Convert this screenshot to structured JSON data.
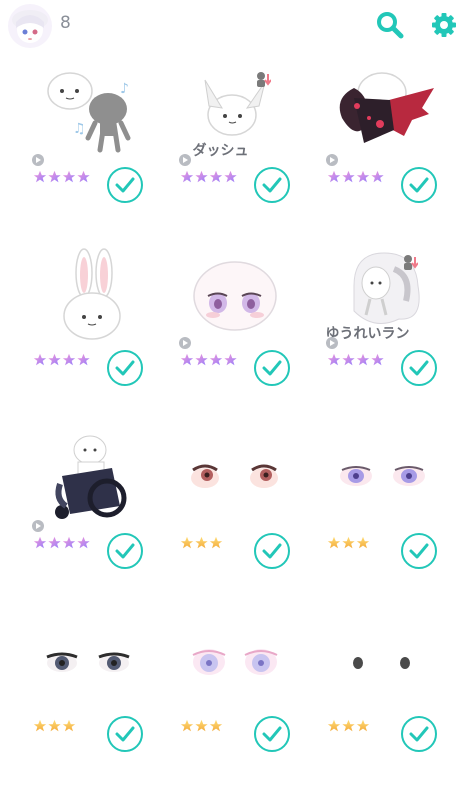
{
  "header": {
    "avatar_icon": "character-avatar-icon",
    "count": "8",
    "search_icon": "search-icon",
    "settings_icon": "gear-icon",
    "accent": "#22c7b8"
  },
  "items": [
    {
      "art": "music-bodies",
      "caption": "",
      "stars": 4,
      "star_color": "purple",
      "has_play": true,
      "checked": true
    },
    {
      "art": "cat-ears",
      "caption": "ダッシュ",
      "stars": 4,
      "star_color": "purple",
      "has_play": true,
      "checked": true
    },
    {
      "art": "dragon",
      "caption": "",
      "stars": 4,
      "star_color": "purple",
      "has_play": true,
      "checked": true
    },
    {
      "art": "bunny",
      "caption": "",
      "stars": 4,
      "star_color": "purple",
      "has_play": false,
      "checked": true
    },
    {
      "art": "blush-face",
      "caption": "",
      "stars": 4,
      "star_color": "purple",
      "has_play": true,
      "checked": true
    },
    {
      "art": "ghost-hair",
      "caption": "ゆうれいラン",
      "stars": 4,
      "star_color": "purple",
      "has_play": true,
      "checked": true
    },
    {
      "art": "wheelchair",
      "caption": "",
      "stars": 4,
      "star_color": "purple",
      "has_play": true,
      "checked": true
    },
    {
      "art": "eyes-red",
      "caption": "",
      "stars": 3,
      "star_color": "gold",
      "has_play": false,
      "checked": true
    },
    {
      "art": "eyes-violet",
      "caption": "",
      "stars": 3,
      "star_color": "gold",
      "has_play": false,
      "checked": true
    },
    {
      "art": "eyes-dark",
      "caption": "",
      "stars": 3,
      "star_color": "gold",
      "has_play": false,
      "checked": true
    },
    {
      "art": "eyes-pink",
      "caption": "",
      "stars": 3,
      "star_color": "gold",
      "has_play": false,
      "checked": true
    },
    {
      "art": "eyes-dots",
      "caption": "",
      "stars": 3,
      "star_color": "gold",
      "has_play": false,
      "checked": true
    }
  ]
}
